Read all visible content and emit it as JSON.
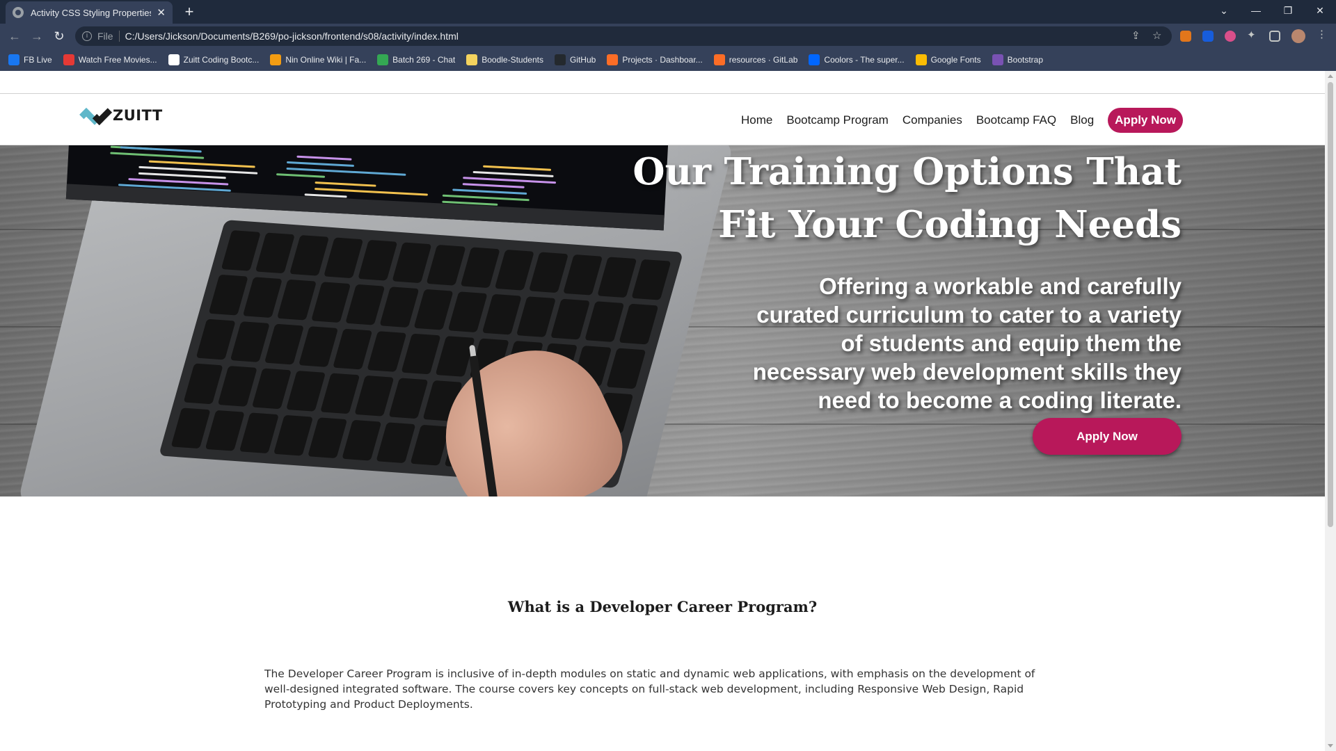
{
  "browser": {
    "tab_title": "Activity CSS Styling Properties an",
    "url_scheme": "File",
    "url": "C:/Users/Jickson/Documents/B269/po-jickson/frontend/s08/activity/index.html",
    "bookmarks": [
      {
        "label": "FB Live",
        "icon": "facebook-icon",
        "color": "#1877f2"
      },
      {
        "label": "Watch Free Movies...",
        "icon": "play-icon",
        "color": "#e53935"
      },
      {
        "label": "Zuitt Coding Bootc...",
        "icon": "zuitt-icon",
        "color": "#ffffff"
      },
      {
        "label": "Nin Online Wiki | Fa...",
        "icon": "wiki-icon",
        "color": "#f39c12"
      },
      {
        "label": "Batch 269 - Chat",
        "icon": "chat-icon",
        "color": "#34a853"
      },
      {
        "label": "Boodle-Students",
        "icon": "folder-icon",
        "color": "#f4d35e"
      },
      {
        "label": "GitHub",
        "icon": "github-icon",
        "color": "#24292e"
      },
      {
        "label": "Projects · Dashboar...",
        "icon": "gitlab-icon",
        "color": "#fc6d26"
      },
      {
        "label": "resources · GitLab",
        "icon": "gitlab-icon",
        "color": "#fc6d26"
      },
      {
        "label": "Coolors - The super...",
        "icon": "coolors-icon",
        "color": "#0066ff"
      },
      {
        "label": "Google Fonts",
        "icon": "google-fonts-icon",
        "color": "#fbbc04"
      },
      {
        "label": "Bootstrap",
        "icon": "bootstrap-icon",
        "color": "#7952b3"
      }
    ]
  },
  "site": {
    "logo_text": "ZUITT",
    "nav": [
      "Home",
      "Bootcamp Program",
      "Companies",
      "Bootcamp FAQ",
      "Blog"
    ],
    "nav_cta": "Apply Now",
    "accent_color": "#b8185a"
  },
  "hero": {
    "title_line1": "Our Training Options That",
    "title_line2": "Fit Your Coding Needs",
    "subtitle": "Offering a workable and carefully curated curriculum to cater to a variety of students and equip them the necessary web development skills they need to become a coding literate.",
    "button": "Apply Now"
  },
  "section": {
    "title": "What is a Developer Career Program?",
    "body": "The Developer Career Program is inclusive of in-depth modules on static and dynamic web applications, with emphasis on the development of well-designed integrated software. The course covers key concepts on full-stack web development, including Responsive Web Design, Rapid Prototyping and Product Deployments."
  }
}
